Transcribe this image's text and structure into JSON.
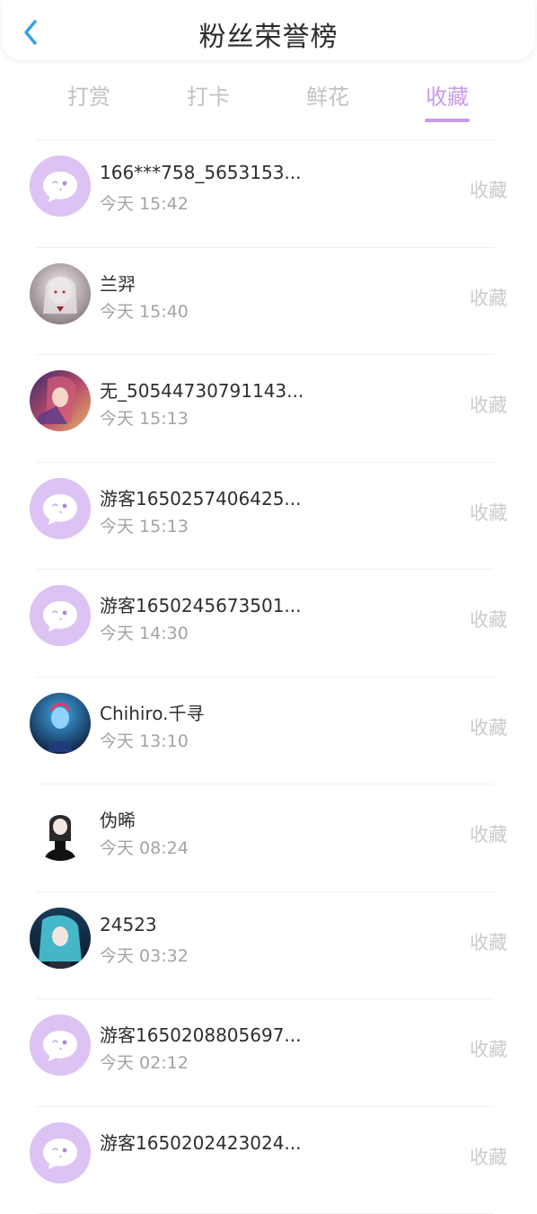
{
  "header": {
    "title": "粉丝荣誉榜",
    "back_icon": "chevron-left-icon"
  },
  "tabs": [
    {
      "label": "打赏"
    },
    {
      "label": "打卡"
    },
    {
      "label": "鲜花"
    },
    {
      "label": "收藏"
    }
  ],
  "active_tab": "收藏",
  "colors": {
    "accent": "#c79be6",
    "default_avatar": "#dcc3f4"
  },
  "list": [
    {
      "name": "166***758_5653153...",
      "time": "今天 15:42",
      "action": "收藏",
      "avatar": "default-chat-avatar"
    },
    {
      "name": "兰羿",
      "time": "今天 15:40",
      "action": "收藏",
      "avatar": "anime-white-hair-avatar"
    },
    {
      "name": "无_50544730791143...",
      "time": "今天 15:13",
      "action": "收藏",
      "avatar": "anime-fantasy-avatar"
    },
    {
      "name": "游客1650257406425...",
      "time": "今天 15:13",
      "action": "收藏",
      "avatar": "default-chat-avatar"
    },
    {
      "name": "游客1650245673501...",
      "time": "今天 14:30",
      "action": "收藏",
      "avatar": "default-chat-avatar"
    },
    {
      "name": "Chihiro.千寻",
      "time": "今天 13:10",
      "action": "收藏",
      "avatar": "anime-blue-character-avatar"
    },
    {
      "name": "伪晞",
      "time": "今天 08:24",
      "action": "收藏",
      "avatar": "girl-in-black-avatar"
    },
    {
      "name": "24523",
      "time": "今天 03:32",
      "action": "收藏",
      "avatar": "anime-teal-hair-avatar"
    },
    {
      "name": "游客1650208805697...",
      "time": "今天 02:12",
      "action": "收藏",
      "avatar": "default-chat-avatar"
    },
    {
      "name": "游客1650202423024...",
      "time": "",
      "action": "收藏",
      "avatar": "default-chat-avatar"
    }
  ]
}
